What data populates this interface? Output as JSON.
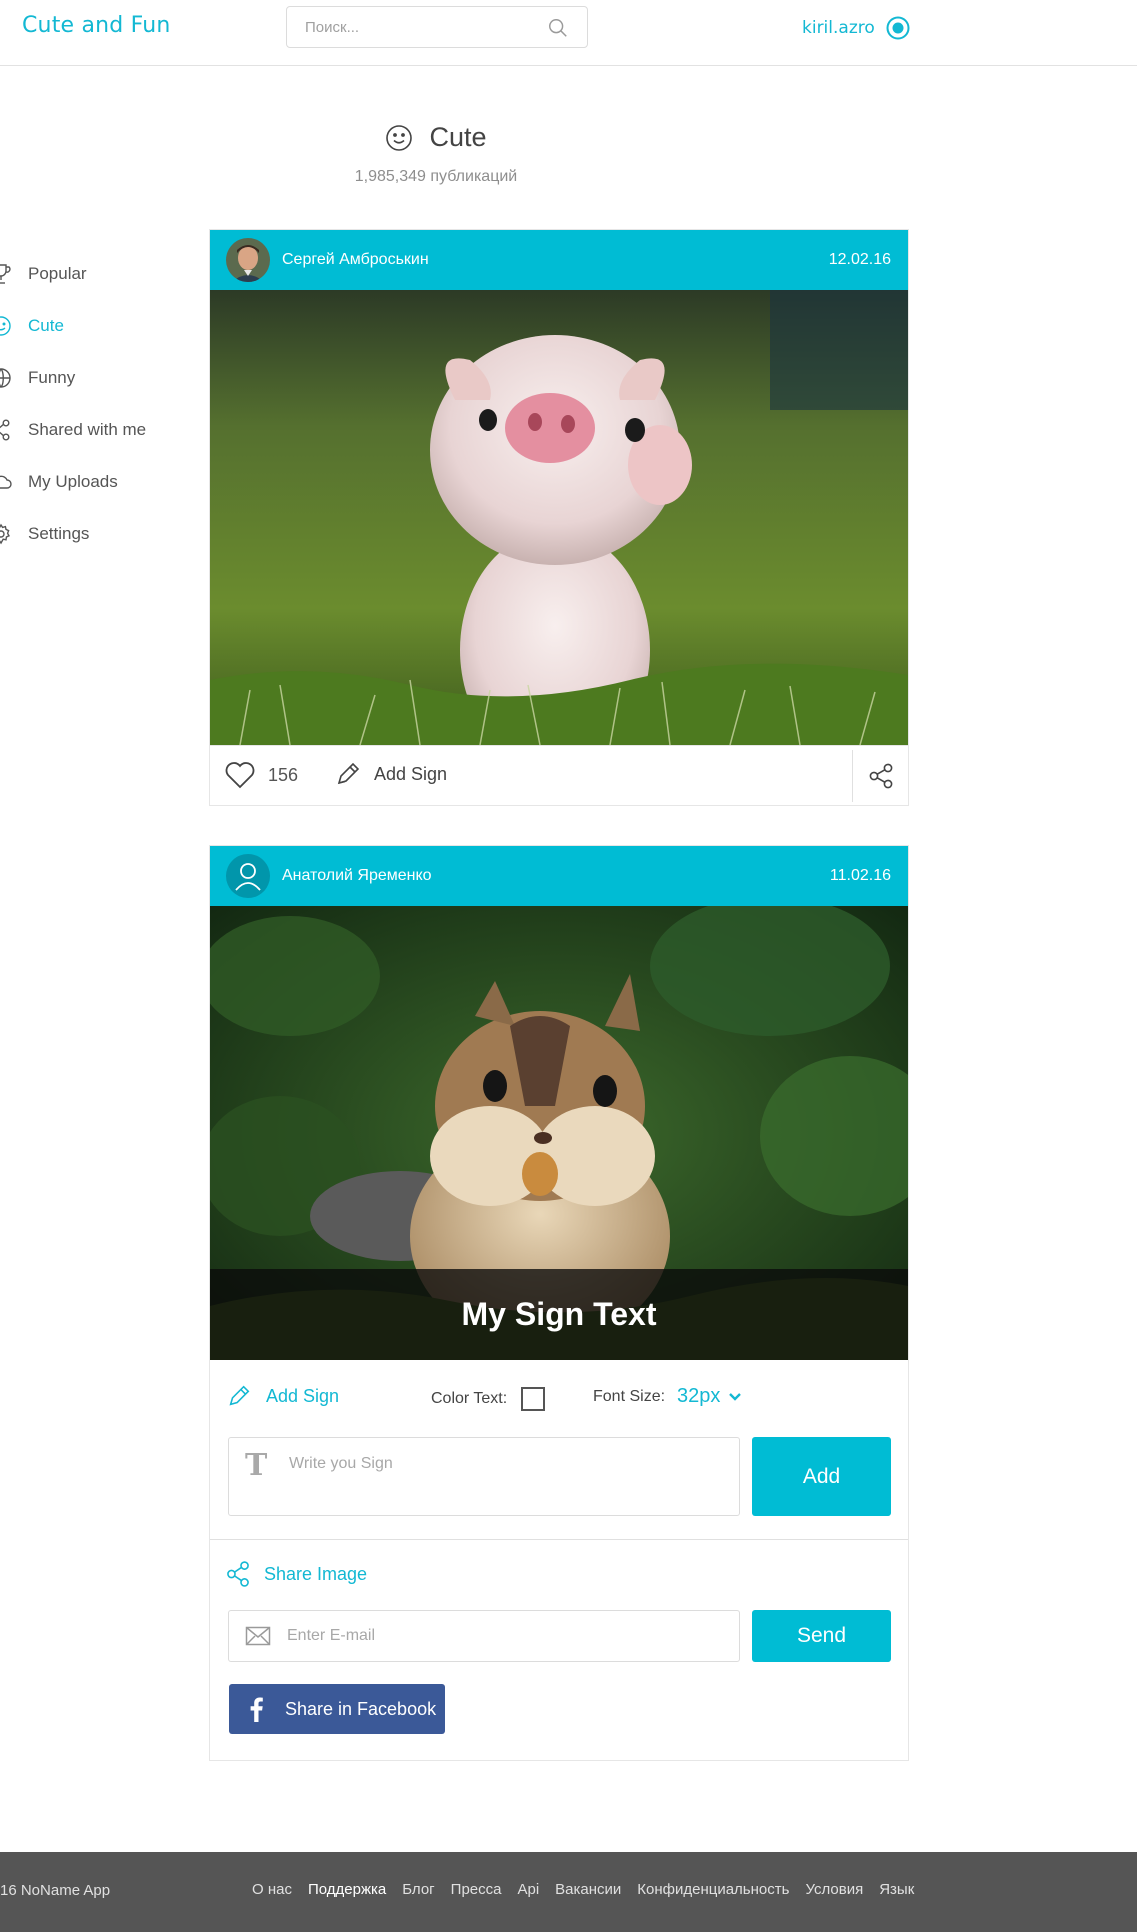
{
  "brand": {
    "logo": "Cute and Fun",
    "accent": "#00bcd4"
  },
  "search": {
    "placeholder": "Поиск...",
    "icon": "search-icon"
  },
  "user": {
    "name": "kiril.azro",
    "icon": "user-target-icon"
  },
  "category": {
    "title": "Cute",
    "count": "1,985,349 публикаций",
    "icon": "smiley-icon"
  },
  "sidebar": {
    "items": [
      {
        "label": "Popular",
        "icon": "trophy-icon",
        "active": false
      },
      {
        "label": "Cute",
        "icon": "smiley-icon",
        "active": true
      },
      {
        "label": "Funny",
        "icon": "ball-icon",
        "active": false
      },
      {
        "label": "Shared with me",
        "icon": "share-icon",
        "active": false
      },
      {
        "label": "My Uploads",
        "icon": "cloud-icon",
        "active": false
      },
      {
        "label": "Settings",
        "icon": "gear-icon",
        "active": false
      }
    ]
  },
  "posts": [
    {
      "author": "Сергей Амброськин",
      "date": "12.02.16",
      "image": "piglet-photo",
      "likes": "156",
      "add_sign": "Add Sign"
    },
    {
      "author": "Анатолий Яременко",
      "date": "11.02.16",
      "image": "chipmunk-photo",
      "sign_text": "My Sign Text"
    }
  ],
  "editor": {
    "add_sign": "Add Sign",
    "color_text_label": "Color Text:",
    "color_text_checked": false,
    "font_size_label": "Font Size:",
    "font_size_value": "32px",
    "sign_placeholder": "Write you Sign",
    "add_button": "Add"
  },
  "share": {
    "title": "Share Image",
    "email_placeholder": "Enter E-mail",
    "send_button": "Send",
    "facebook_button": "Share in Facebook",
    "facebook_color": "#3b5998"
  },
  "footer": {
    "copyright": "16 NoName App",
    "links": [
      {
        "label": "О нас",
        "active": false
      },
      {
        "label": "Поддержка",
        "active": true
      },
      {
        "label": "Блог",
        "active": false
      },
      {
        "label": "Пресса",
        "active": false
      },
      {
        "label": "Api",
        "active": false
      },
      {
        "label": "Вакансии",
        "active": false
      },
      {
        "label": "Конфиденциальность",
        "active": false
      },
      {
        "label": "Условия",
        "active": false
      },
      {
        "label": "Язык",
        "active": false
      }
    ]
  }
}
